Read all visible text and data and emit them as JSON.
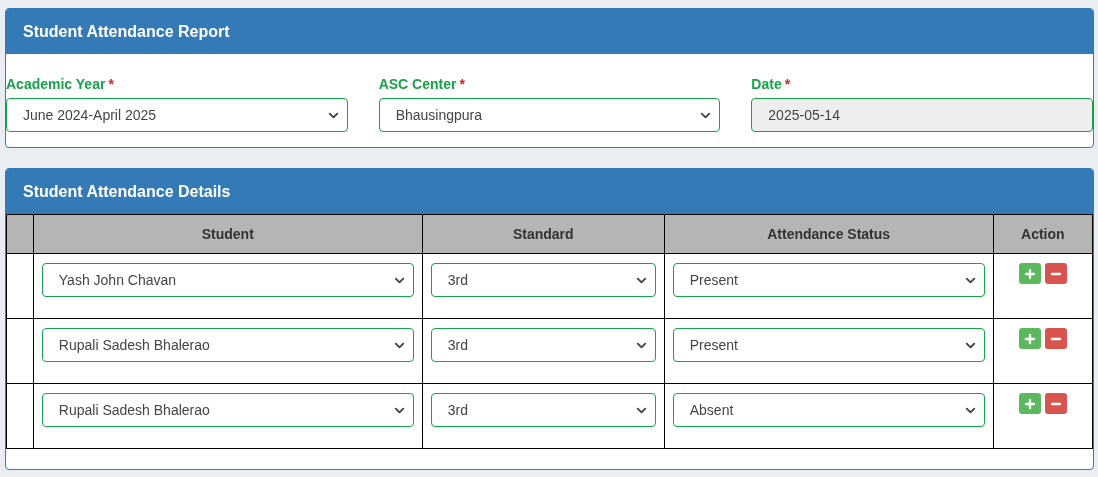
{
  "report_panel": {
    "title": "Student Attendance Report",
    "fields": [
      {
        "label": "Academic Year",
        "required_mark": "*",
        "value": "June 2024-April 2025",
        "disabled": false
      },
      {
        "label": "ASC Center",
        "required_mark": "*",
        "value": "Bhausingpura",
        "disabled": false
      },
      {
        "label": "Date",
        "required_mark": "*",
        "value": "2025-05-14",
        "disabled": true
      }
    ]
  },
  "details_panel": {
    "title": "Student Attendance Details",
    "table": {
      "columns": [
        "Student",
        "Standard",
        "Attendance Status",
        "Action"
      ],
      "rows": [
        {
          "student": "Yash John Chavan",
          "standard": "3rd",
          "status": "Present"
        },
        {
          "student": "Rupali Sadesh Bhalerao",
          "standard": "3rd",
          "status": "Present"
        },
        {
          "student": "Rupali Sadesh Bhalerao",
          "standard": "3rd",
          "status": "Absent"
        }
      ]
    }
  }
}
